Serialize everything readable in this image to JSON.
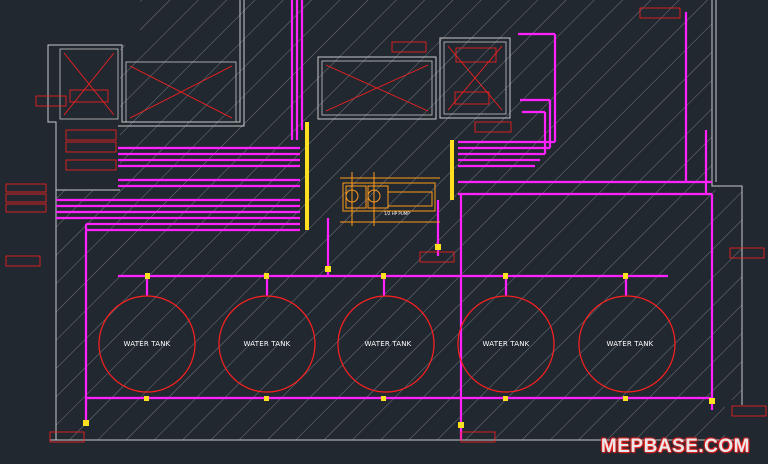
{
  "drawing": {
    "tanks": [
      {
        "label": "WATER TANK"
      },
      {
        "label": "WATER TANK"
      },
      {
        "label": "WATER TANK"
      },
      {
        "label": "WATER TANK"
      },
      {
        "label": "WATER TANK"
      }
    ],
    "pump_label": "1/2 HP PUMP",
    "watermark": "MEPBASE.COM",
    "colors": {
      "background": "#222830",
      "wall": "#c8c8c8",
      "hatch": "#7a7f88",
      "pipe": "#ff22ff",
      "tank": "#ff2020",
      "pump": "#ff9a1a",
      "fitting": "#ffe020",
      "label_box": "#ff2020"
    },
    "icons": [
      "shaft-cross-icon",
      "pump-icon",
      "valve-icon",
      "tag-box-icon"
    ]
  }
}
